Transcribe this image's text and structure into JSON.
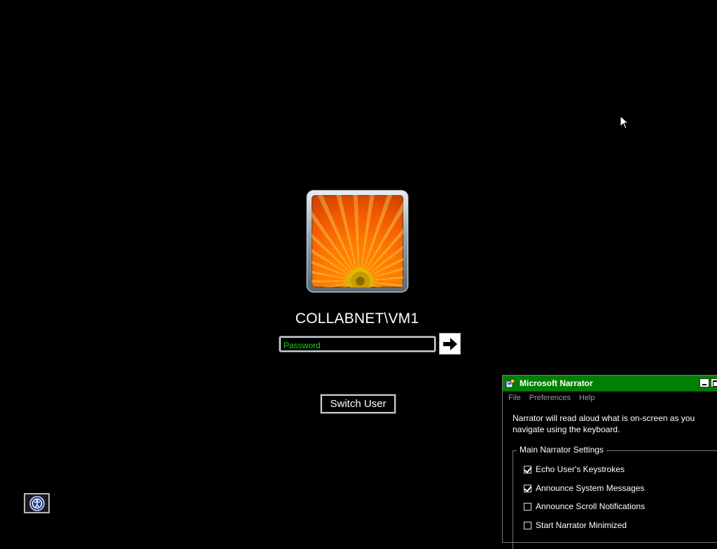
{
  "login": {
    "username": "COLLABNET\\VM1",
    "password_placeholder": "Password",
    "password_value": "",
    "switch_user_label": "Switch User"
  },
  "icons": {
    "submit": "arrow-right-icon",
    "ease_of_access": "ease-of-access-icon",
    "cursor": "mouse-pointer-icon",
    "avatar": "flower-user-picture"
  },
  "narrator": {
    "title": "Microsoft Narrator",
    "menu": [
      "File",
      "Preferences",
      "Help"
    ],
    "description": "Narrator will read aloud what is on-screen as you navigate using the keyboard.",
    "group_title": "Main Narrator Settings",
    "options": [
      {
        "label": "Echo User's Keystrokes",
        "checked": true
      },
      {
        "label": "Announce System Messages",
        "checked": true
      },
      {
        "label": "Announce Scroll Notifications",
        "checked": false
      },
      {
        "label": "Start Narrator Minimized",
        "checked": false
      }
    ]
  },
  "colors": {
    "background": "#000000",
    "password_text": "#19d419",
    "narrator_titlebar": "#008000"
  }
}
